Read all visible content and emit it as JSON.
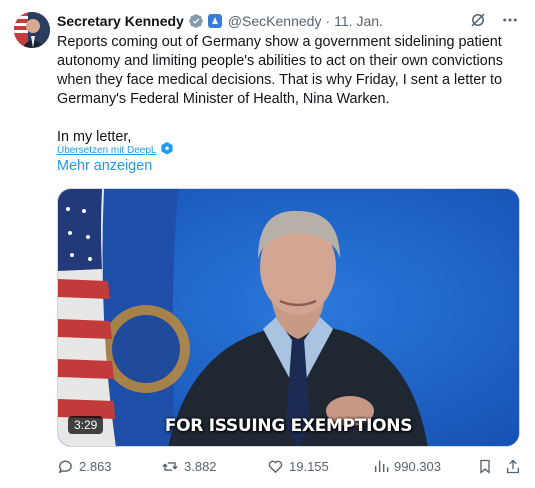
{
  "post": {
    "author_name": "Secretary Kennedy",
    "handle": "@SecKennedy",
    "separator": "·",
    "date": "11. Jan.",
    "text_lines": [
      "Reports coming out of Germany show a government sidelining patient",
      "autonomy and limiting people's abilities to act on their own convictions",
      "when they face medical decisions. That is why Friday, I sent a letter to",
      "Germany's Federal Minister of Health, Nina Warken."
    ],
    "text_second": "In my letter,",
    "translate_label": "Übersetzen mit DeepL",
    "show_more_label": "Mehr anzeigen"
  },
  "media": {
    "caption": "FOR ISSUING EXEMPTIONS",
    "duration": "3:29"
  },
  "actions": {
    "replies": "2.863",
    "reposts": "3.882",
    "likes": "19.155",
    "views": "990.303"
  },
  "colors": {
    "accent": "#1d9bf0",
    "verified": "#829aab",
    "secondary_text": "#536471",
    "video_background": "#1e62c4"
  },
  "icons": [
    "verified-badge-icon",
    "government-badge-icon",
    "grok-icon",
    "more-icon",
    "deepl-icon",
    "reply-icon",
    "repost-icon",
    "like-icon",
    "views-icon",
    "bookmark-icon",
    "share-icon"
  ]
}
